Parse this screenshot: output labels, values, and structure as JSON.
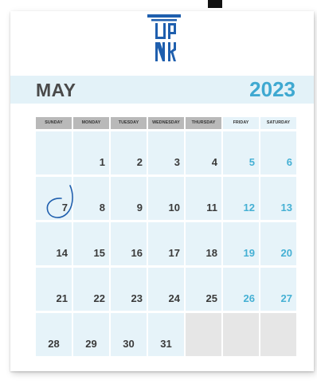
{
  "calendar": {
    "month": "MAY",
    "year": "2023",
    "weekdays": [
      "SUNDAY",
      "MONDAY",
      "TUESDAY",
      "WEDNESDAY",
      "THURSDAY",
      "FRIDAY",
      "SATURDAY"
    ],
    "weeks": [
      [
        "",
        "1",
        "2",
        "3",
        "4",
        "5",
        "6"
      ],
      [
        "7",
        "8",
        "9",
        "10",
        "11",
        "12",
        "13"
      ],
      [
        "14",
        "15",
        "16",
        "17",
        "18",
        "19",
        "20"
      ],
      [
        "21",
        "22",
        "23",
        "24",
        "25",
        "26",
        "27"
      ],
      [
        "28",
        "29",
        "30",
        "31",
        "",
        "",
        ""
      ]
    ],
    "circled_date": "7"
  },
  "colors": {
    "accent_blue": "#1f5fae",
    "weekend_text": "#45b0d4",
    "cell_bg": "#e6f3f9",
    "weekday_header_bg": "#b9b9b9"
  }
}
